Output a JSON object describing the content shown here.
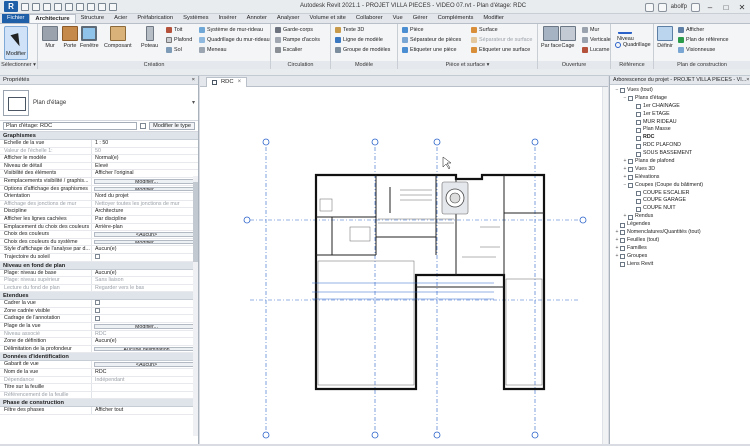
{
  "titlebar": {
    "app_icon_label": "R",
    "title": "Autodesk Revit 2021.1 - PROJET VILLA PIECES - VIDEO 07.rvt - Plan d'étage: RDC",
    "user": "abolfp",
    "minimize": "–",
    "maximize": "□",
    "close": "✕"
  },
  "tabs": [
    "Fichier",
    "Architecture",
    "Structure",
    "Acier",
    "Préfabrication",
    "Systèmes",
    "Insérer",
    "Annoter",
    "Analyser",
    "Volume et site",
    "Collaborer",
    "Vue",
    "Gérer",
    "Compléments",
    "Modifier"
  ],
  "ribbon": {
    "select": {
      "modify": "Modifier",
      "panel": "Sélectionner ▾"
    },
    "creation": {
      "panel": "Création",
      "big": [
        "Mur",
        "Porte",
        "Fenêtre",
        "Composant",
        "Poteau"
      ],
      "col1": [
        "Toit",
        "Plafond",
        "Sol"
      ],
      "col2": [
        "Système de mur-rideau",
        "Quadrillage du mur-rideau",
        "Meneau"
      ]
    },
    "circulation": {
      "panel": "Circulation",
      "items": [
        "Garde-corps",
        "Rampe d'accès",
        "Escalier"
      ]
    },
    "modele": {
      "panel": "Modèle",
      "items": [
        "Texte 3D",
        "Ligne de modèle",
        "Groupe de modèles"
      ]
    },
    "piece": {
      "panel": "Pièce et surface ▾",
      "col1": [
        "Pièce",
        "Séparateur de pièces",
        "Etiqueter une pièce"
      ],
      "col2": [
        "Surface",
        "Séparateur de surface",
        "Etiqueter une surface"
      ]
    },
    "ouverture": {
      "panel": "Ouverture",
      "big": [
        "Par face",
        "Cage"
      ],
      "col": [
        "Mur",
        "Verticale",
        "Lucarne"
      ]
    },
    "reference": {
      "panel": "Référence",
      "big": [
        "Niveau",
        "Quadrillage"
      ]
    },
    "plan": {
      "panel": "Plan de construction",
      "big": "Définir",
      "col": [
        "Afficher",
        "Plan de référence",
        "Visionneuse"
      ]
    }
  },
  "properties": {
    "title": "Propriétés",
    "close": "×",
    "type_name": "Plan d'étage",
    "instance": "Plan d'étage: RDC",
    "edit_type": "Modifier le type",
    "sections": [
      {
        "name": "Graphismes",
        "rows": [
          {
            "n": "Echelle de la vue",
            "v": "1 : 50"
          },
          {
            "n": "Valeur de l'échelle    1:",
            "v": "50",
            "grey": true
          },
          {
            "n": "Afficher le modèle",
            "v": "Normal(e)"
          },
          {
            "n": "Niveau de détail",
            "v": "Elevé"
          },
          {
            "n": "Visibilité des éléments",
            "v": "Afficher l'original"
          },
          {
            "n": "Remplacements visibilité / graphis...",
            "v": "Modifier...",
            "btn": true
          },
          {
            "n": "Options d'affichage des graphismes",
            "v": "Modifier...",
            "btn": true
          },
          {
            "n": "Orientation",
            "v": "Nord du projet"
          },
          {
            "n": "Affichage des jonctions de mur",
            "v": "Nettoyer toutes les jonctions de mur",
            "grey": true
          },
          {
            "n": "Discipline",
            "v": "Architecture"
          },
          {
            "n": "Afficher les lignes cachées",
            "v": "Par discipline"
          },
          {
            "n": "Emplacement du choix des couleurs",
            "v": "Arrière-plan"
          },
          {
            "n": "Choix des couleurs",
            "v": "<Aucun>",
            "btn": true
          },
          {
            "n": "Choix des couleurs du système",
            "v": "Modifier...",
            "btn": true
          },
          {
            "n": "Style d'affichage de l'analyse par d...",
            "v": "Aucun(e)"
          },
          {
            "n": "Trajectoire du soleil",
            "v": "",
            "cb": true
          }
        ]
      },
      {
        "name": "Niveau en fond de plan",
        "rows": [
          {
            "n": "Plage: niveau de base",
            "v": "Aucun(e)"
          },
          {
            "n": "Plage: niveau supérieur",
            "v": "Sans liaison",
            "grey": true
          },
          {
            "n": "Lecture du fond de plan",
            "v": "Regarder vers le bas",
            "grey": true
          }
        ]
      },
      {
        "name": "Etendues",
        "rows": [
          {
            "n": "Cadrer la vue",
            "v": "",
            "cb": true
          },
          {
            "n": "Zone cadrée visible",
            "v": "",
            "cb": true
          },
          {
            "n": "Cadrage de l'annotation",
            "v": "",
            "cb": true
          },
          {
            "n": "Plage de la vue",
            "v": "Modifier...",
            "btn": true
          },
          {
            "n": "Niveau associé",
            "v": "RDC",
            "grey": true
          },
          {
            "n": "Zone de définition",
            "v": "Aucun(e)"
          },
          {
            "n": "Délimitation de la profondeur",
            "v": "Aucune délimitation",
            "btn": true
          }
        ]
      },
      {
        "name": "Données d'identification",
        "rows": [
          {
            "n": "Gabarit de vue",
            "v": "<Aucun>",
            "btn": true
          },
          {
            "n": "Nom de la vue",
            "v": "RDC"
          },
          {
            "n": "Dépendance",
            "v": "Indépendant",
            "grey": true
          },
          {
            "n": "Titre sur la feuille",
            "v": ""
          },
          {
            "n": "Référencement de la feuille",
            "v": "",
            "grey": true
          }
        ]
      },
      {
        "name": "Phase de construction",
        "rows": [
          {
            "n": "Filtre des phases",
            "v": "Afficher tout"
          }
        ]
      }
    ]
  },
  "view": {
    "tab": "RDC",
    "close": "×"
  },
  "browser": {
    "title": "Arborescence du projet - PROJET VILLA PIECES - VI...",
    "close": "×",
    "items": [
      {
        "d": 0,
        "t": "−",
        "label": "Vues (tout)"
      },
      {
        "d": 1,
        "t": "−",
        "label": "Plans d'étage"
      },
      {
        "d": 2,
        "t": "",
        "label": "1er CHAINAGE"
      },
      {
        "d": 2,
        "t": "",
        "label": "1er ETAGE"
      },
      {
        "d": 2,
        "t": "",
        "label": "MUR RIDEAU"
      },
      {
        "d": 2,
        "t": "",
        "label": "Plan Masse"
      },
      {
        "d": 2,
        "t": "",
        "label": "RDC",
        "bold": true
      },
      {
        "d": 2,
        "t": "",
        "label": "RDC PLAFOND"
      },
      {
        "d": 2,
        "t": "",
        "label": "SOUS BASSEMENT"
      },
      {
        "d": 1,
        "t": "+",
        "label": "Plans de plafond"
      },
      {
        "d": 1,
        "t": "+",
        "label": "Vues 3D"
      },
      {
        "d": 1,
        "t": "+",
        "label": "Elévations"
      },
      {
        "d": 1,
        "t": "−",
        "label": "Coupes (Coupe du bâtiment)"
      },
      {
        "d": 2,
        "t": "",
        "label": "COUPE ESCALIER"
      },
      {
        "d": 2,
        "t": "",
        "label": "COUPE GARAGE"
      },
      {
        "d": 2,
        "t": "",
        "label": "COUPE NUIT"
      },
      {
        "d": 1,
        "t": "+",
        "label": "Rendus"
      },
      {
        "d": 0,
        "t": "",
        "label": "Légendes"
      },
      {
        "d": 0,
        "t": "+",
        "label": "Nomenclatures/Quantités (tout)"
      },
      {
        "d": 0,
        "t": "+",
        "label": "Feuilles (tout)"
      },
      {
        "d": 0,
        "t": "+",
        "label": "Familles"
      },
      {
        "d": 0,
        "t": "+",
        "label": "Groupes"
      },
      {
        "d": 0,
        "t": "",
        "label": "Liens Revit"
      }
    ]
  },
  "colors": {
    "accent": "#1f5fa8",
    "grid_line": "#2a62c9",
    "wall": "#111111"
  }
}
